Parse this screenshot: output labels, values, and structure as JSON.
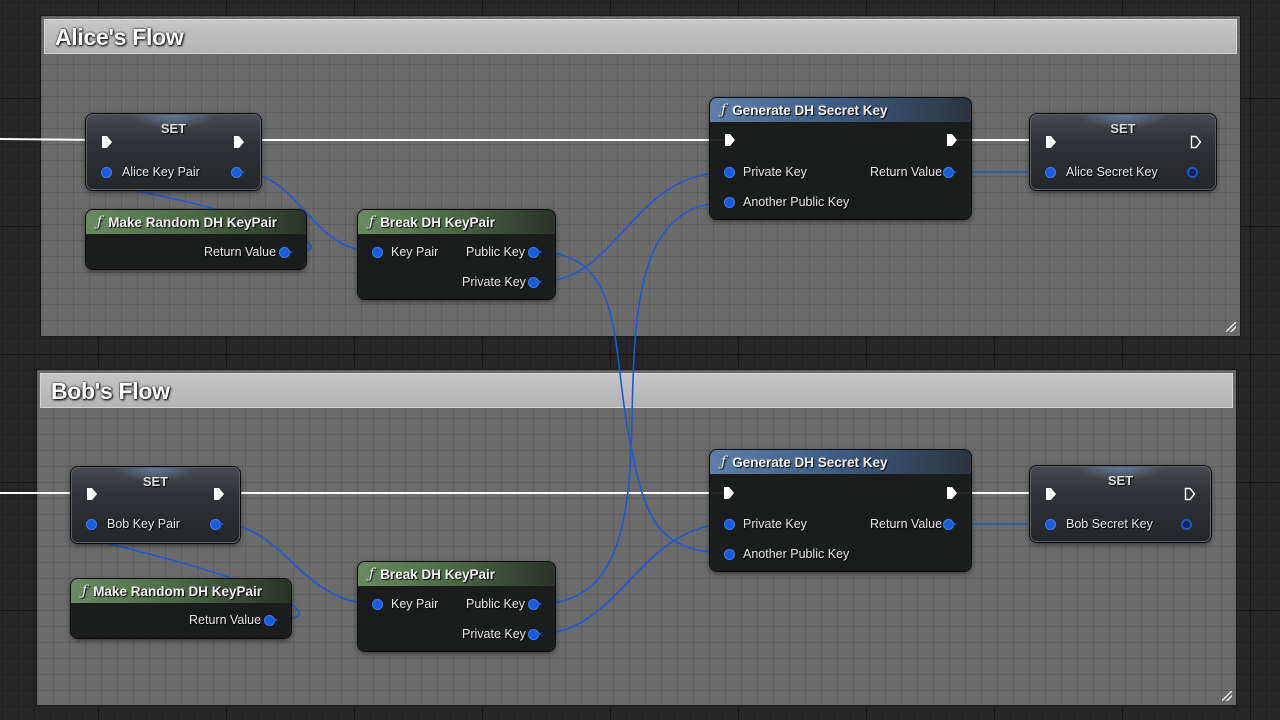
{
  "comments": {
    "alice": {
      "title": "Alice's Flow"
    },
    "bob": {
      "title": "Bob's Flow"
    }
  },
  "alice": {
    "set_key_pair": {
      "title": "SET",
      "var_label": "Alice Key Pair"
    },
    "make_random": {
      "title": "Make Random DH KeyPair",
      "return_label": "Return Value"
    },
    "break_pair": {
      "title": "Break DH KeyPair",
      "key_pair_label": "Key Pair",
      "public_key_label": "Public Key",
      "private_key_label": "Private Key"
    },
    "generate_secret": {
      "title": "Generate DH Secret Key",
      "private_key_label": "Private Key",
      "another_public_key_label": "Another Public Key",
      "return_label": "Return Value"
    },
    "set_secret": {
      "title": "SET",
      "var_label": "Alice Secret Key"
    }
  },
  "bob": {
    "set_key_pair": {
      "title": "SET",
      "var_label": "Bob Key Pair"
    },
    "make_random": {
      "title": "Make Random DH KeyPair",
      "return_label": "Return Value"
    },
    "break_pair": {
      "title": "Break DH KeyPair",
      "key_pair_label": "Key Pair",
      "public_key_label": "Public Key",
      "private_key_label": "Private Key"
    },
    "generate_secret": {
      "title": "Generate DH Secret Key",
      "private_key_label": "Private Key",
      "another_public_key_label": "Another Public Key",
      "return_label": "Return Value"
    },
    "set_secret": {
      "title": "SET",
      "var_label": "Bob Secret Key"
    }
  },
  "colors": {
    "data_wire": "#1b5bd8",
    "exec_wire": "#ffffff",
    "pure_header": "#5e7d57",
    "function_header": "#4f71a0"
  },
  "icons": {
    "function": "function-f-icon",
    "exec_pin": "exec-arrow-icon",
    "data_pin": "struct-pin-icon"
  }
}
